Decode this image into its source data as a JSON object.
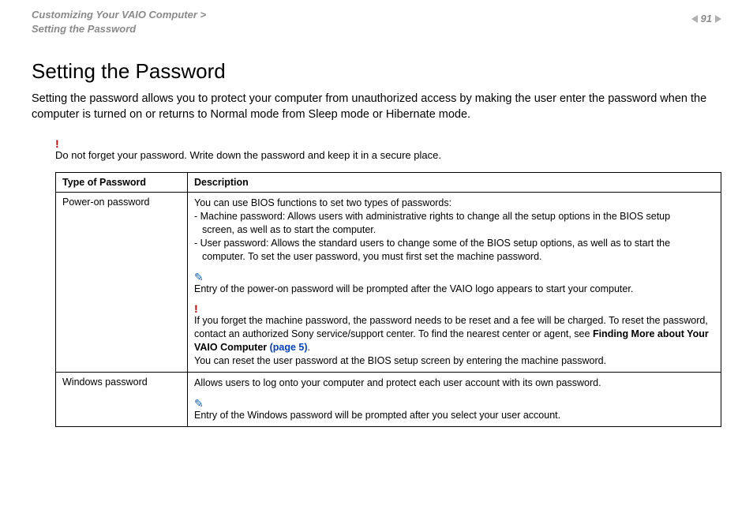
{
  "header": {
    "breadcrumb_line1": "Customizing Your VAIO Computer >",
    "breadcrumb_line2": "Setting the Password",
    "page_number": "91"
  },
  "title": "Setting the Password",
  "intro": "Setting the password allows you to protect your computer from unauthorized access by making the user enter the password when the computer is turned on or returns to Normal mode from Sleep mode or Hibernate mode.",
  "warning_bang": "!",
  "warning_text": "Do not forget your password. Write down the password and keep it in a secure place.",
  "table": {
    "head_type": "Type of Password",
    "head_desc": "Description",
    "row1": {
      "type": "Power-on password",
      "p1": "You can use BIOS functions to set two types of passwords:",
      "p2a": "- Machine password: Allows users with administrative rights to change all the setup options in the BIOS setup",
      "p2b": "screen, as well as to start the computer.",
      "p3a": "- User password: Allows the standard users to change some of the BIOS setup options, as well as to start the",
      "p3b": "computer. To set the user password, you must first set the machine password.",
      "note_icon": "✎",
      "note1": "Entry of the power-on password will be prompted after the VAIO logo appears to start your computer.",
      "bang": "!",
      "warn2a": "If you forget the machine password, the password needs to be reset and a fee will be charged. To reset the password, contact an authorized Sony service/support center. To find the nearest center or agent, see ",
      "warn2b_bold": "Finding More about Your VAIO Computer ",
      "warn2c_link": "(page 5)",
      "warn2d": ".",
      "p4": "You can reset the user password at the BIOS setup screen by entering the machine password."
    },
    "row2": {
      "type": "Windows password",
      "p1": "Allows users to log onto your computer and protect each user account with its own password.",
      "note_icon": "✎",
      "note1": "Entry of the Windows password will be prompted after you select your user account."
    }
  }
}
